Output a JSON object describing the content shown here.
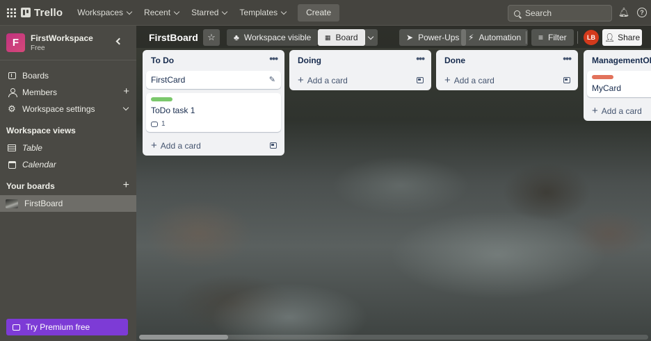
{
  "topbar": {
    "logo": "Trello",
    "nav": [
      "Workspaces",
      "Recent",
      "Starred",
      "Templates"
    ],
    "create": "Create",
    "search_placeholder": "Search"
  },
  "sidebar": {
    "workspace_name": "FirstWorkspace",
    "workspace_initial": "F",
    "workspace_plan": "Free",
    "items": [
      {
        "label": "Boards",
        "icon": "board-icon"
      },
      {
        "label": "Members",
        "icon": "members-icon"
      },
      {
        "label": "Workspace settings",
        "icon": "gear-icon"
      }
    ],
    "views_heading": "Workspace views",
    "views": [
      {
        "label": "Table",
        "icon": "table-icon"
      },
      {
        "label": "Calendar",
        "icon": "calendar-icon"
      }
    ],
    "boards_heading": "Your boards",
    "boards": [
      {
        "label": "FirstBoard"
      }
    ],
    "premium": "Try Premium free"
  },
  "board": {
    "title": "FirstBoard",
    "visibility": "Workspace visible",
    "view": "Board",
    "powerups": "Power-Ups",
    "automation": "Automation",
    "filter": "Filter",
    "avatar_initials": "LB",
    "share": "Share"
  },
  "lists": [
    {
      "title": "To Do",
      "cards": [
        {
          "title": "FirstCard"
        },
        {
          "title": "ToDo task 1",
          "label_color": "#7bc86c",
          "comments": "1"
        }
      ],
      "add_card": "Add a card"
    },
    {
      "title": "Doing",
      "cards": [],
      "add_card": "Add a card"
    },
    {
      "title": "Done",
      "cards": [],
      "add_card": "Add a card"
    },
    {
      "title": "ManagementOPS",
      "cards": [
        {
          "title": "MyCard",
          "label_color": "#e2725b"
        }
      ],
      "add_card": "Add a card"
    }
  ],
  "colors": {
    "premium": "#7d3bd6",
    "workspace_avatar": "#c0327f",
    "user_avatar": "#d33a1c"
  }
}
